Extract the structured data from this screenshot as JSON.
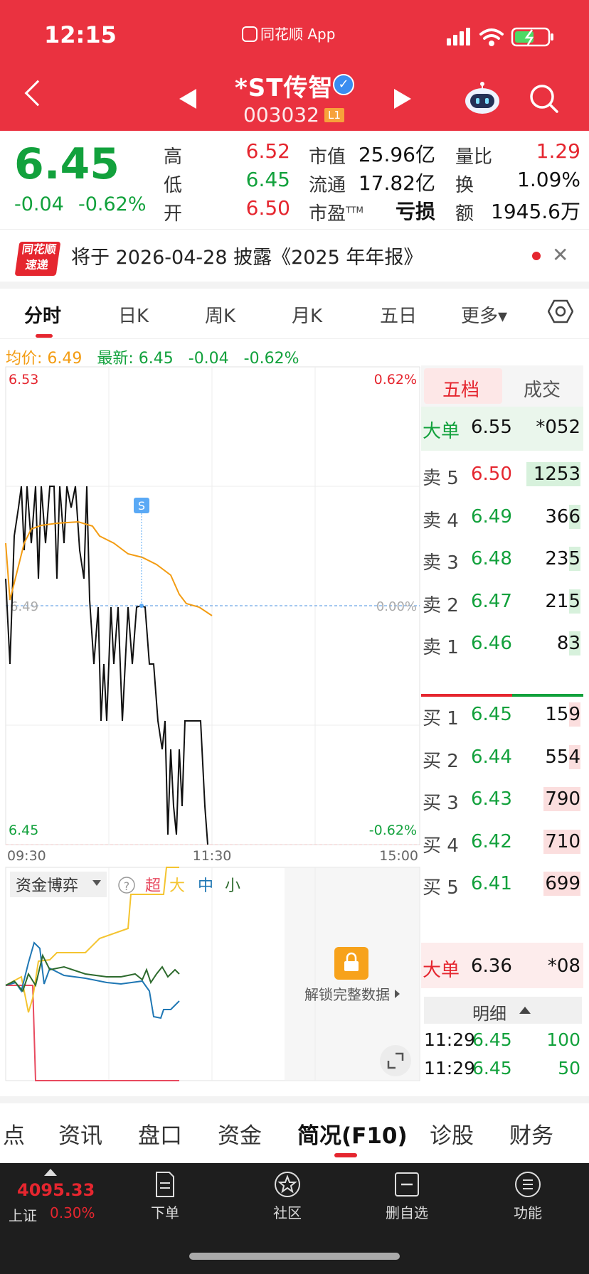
{
  "status_bar": {
    "time": "12:15",
    "app_label": "同花顺 App"
  },
  "header": {
    "name": "*ST传智",
    "code": "003032",
    "level": "L1"
  },
  "quote": {
    "price": "6.45",
    "change": "-0.04",
    "change_pct": "-0.62%",
    "rows": [
      {
        "l1": "高",
        "v1": "6.52",
        "l2": "市值",
        "v2": "25.96亿",
        "l3": "量比",
        "v3": "1.29"
      },
      {
        "l1": "低",
        "v1": "6.45",
        "l2": "流通",
        "v2": "17.82亿",
        "l3": "换",
        "v3": "1.09%"
      },
      {
        "l1": "开",
        "v1": "6.50",
        "l2": "市盈",
        "v2": "亏损",
        "l3": "额",
        "v3": "1945.6万"
      }
    ],
    "pe_suffix": "TTM"
  },
  "notice": {
    "badge_top": "同花顺",
    "badge_bottom": "速递",
    "text": "将于 2026-04-28 披露《2025 年年报》"
  },
  "tabs": [
    "分时",
    "日K",
    "周K",
    "月K",
    "五日",
    "更多▾"
  ],
  "avg_info": {
    "avg_label": "均价: 6.49",
    "latest_label": "最新: 6.45",
    "change": "-0.04",
    "pct": "-0.62%"
  },
  "intraday": {
    "price_high": "6.53",
    "price_low": "6.45",
    "pct_high": "0.62%",
    "pct_low": "-0.62%",
    "ref_label": "6.49",
    "ref_pct": "0.00%",
    "times": [
      "09:30",
      "11:30",
      "15:00"
    ],
    "marker": "S"
  },
  "fund_panel": {
    "selector": "资金博弈",
    "legend": [
      "超",
      "大",
      "中",
      "小"
    ],
    "unlock": "解锁完整数据"
  },
  "order_book": {
    "tabs": [
      "五档",
      "成交"
    ],
    "big_sell": {
      "label": "大单",
      "price": "6.55",
      "vol": "*052"
    },
    "asks": [
      {
        "label": "卖 5",
        "price": "6.50",
        "vol": "1253"
      },
      {
        "label": "卖 4",
        "price": "6.49",
        "vol": "366"
      },
      {
        "label": "卖 3",
        "price": "6.48",
        "vol": "235"
      },
      {
        "label": "卖 2",
        "price": "6.47",
        "vol": "215"
      },
      {
        "label": "卖 1",
        "price": "6.46",
        "vol": "83"
      }
    ],
    "bids": [
      {
        "label": "买 1",
        "price": "6.45",
        "vol": "159"
      },
      {
        "label": "买 2",
        "price": "6.44",
        "vol": "554"
      },
      {
        "label": "买 3",
        "price": "6.43",
        "vol": "790"
      },
      {
        "label": "买 4",
        "price": "6.42",
        "vol": "710"
      },
      {
        "label": "买 5",
        "price": "6.41",
        "vol": "699"
      }
    ],
    "big_buy": {
      "label": "大单",
      "price": "6.36",
      "vol": "*08"
    },
    "detail_label": "明细",
    "trades": [
      {
        "time": "11:29",
        "price": "6.45",
        "vol": "100"
      },
      {
        "time": "11:29",
        "price": "6.45",
        "vol": "50"
      }
    ]
  },
  "bottom_tabs": [
    "点",
    "资讯",
    "盘口",
    "资金",
    "简况(F10)",
    "诊股",
    "财务"
  ],
  "index": {
    "value": "4095.33",
    "name": "上证",
    "pct": "0.30%"
  },
  "nav": [
    "下单",
    "社区",
    "删自选",
    "功能"
  ]
}
